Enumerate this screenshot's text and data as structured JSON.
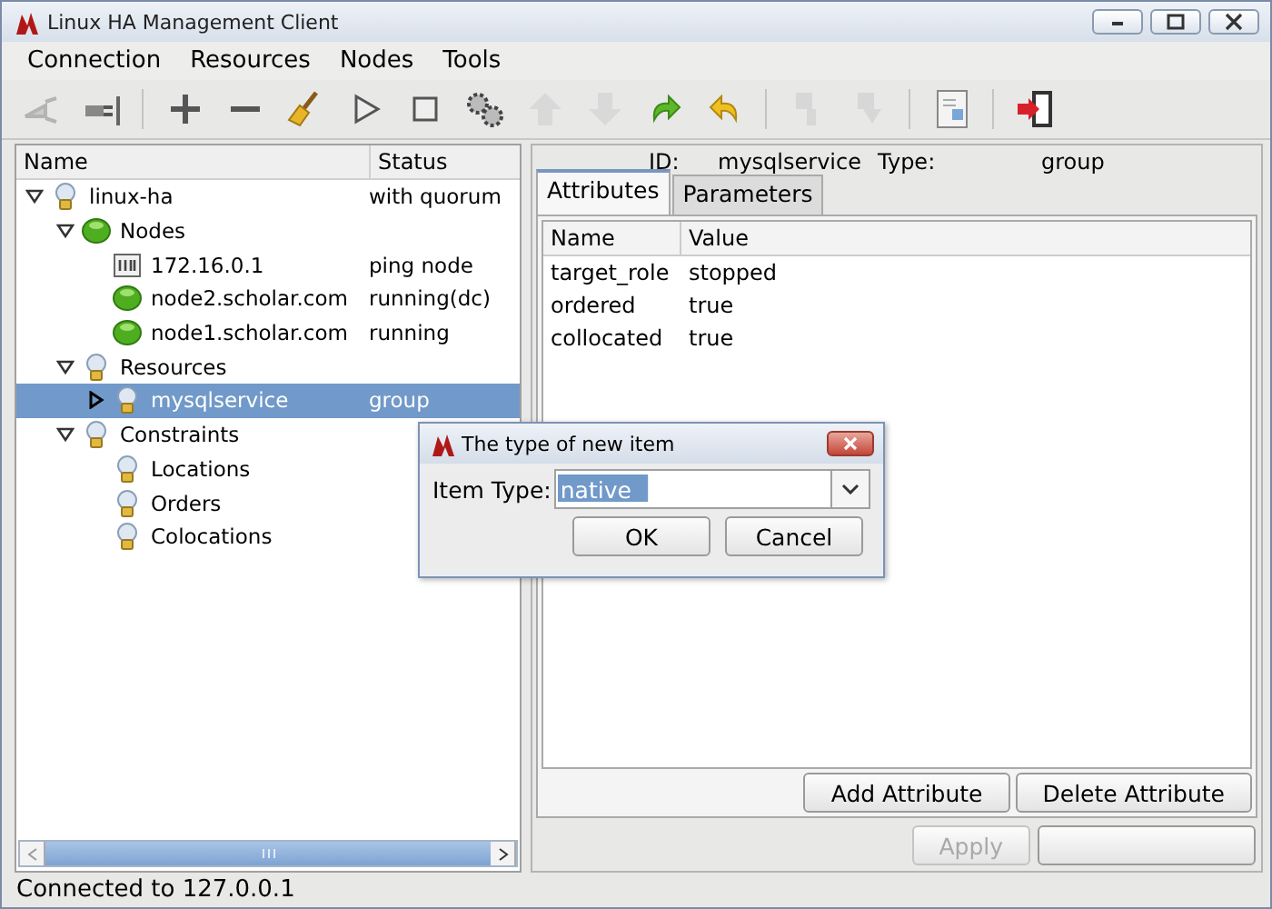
{
  "window": {
    "title": "Linux HA Management Client"
  },
  "menu": [
    "Connection",
    "Resources",
    "Nodes",
    "Tools"
  ],
  "toolbar": [
    {
      "kind": "plug",
      "disabled": true
    },
    {
      "kind": "unplug",
      "disabled": false
    },
    {
      "kind": "separator"
    },
    {
      "kind": "add",
      "disabled": false
    },
    {
      "kind": "remove",
      "disabled": false
    },
    {
      "kind": "broom",
      "disabled": false
    },
    {
      "kind": "play",
      "disabled": false
    },
    {
      "kind": "stop",
      "disabled": false
    },
    {
      "kind": "gears",
      "disabled": false
    },
    {
      "kind": "up",
      "disabled": true
    },
    {
      "kind": "down",
      "disabled": true
    },
    {
      "kind": "redo",
      "disabled": false
    },
    {
      "kind": "undo",
      "disabled": false
    },
    {
      "kind": "separator"
    },
    {
      "kind": "standby",
      "disabled": true
    },
    {
      "kind": "active",
      "disabled": true
    },
    {
      "kind": "separator"
    },
    {
      "kind": "document",
      "disabled": false
    },
    {
      "kind": "separator"
    },
    {
      "kind": "exit",
      "disabled": false
    }
  ],
  "tree": {
    "columns": [
      "Name",
      "Status"
    ],
    "items": [
      {
        "name": "linux-ha",
        "status": "with quorum",
        "kind": "bulb",
        "expanded": true,
        "selected": false,
        "children": [
          {
            "name": "Nodes",
            "kind": "dot",
            "expanded": true,
            "selected": false,
            "children": [
              {
                "name": "172.16.0.1",
                "status": "ping node",
                "kind": "host",
                "selected": false
              },
              {
                "name": "node2.scholar.com",
                "status": "running(dc)",
                "kind": "dot",
                "selected": false
              },
              {
                "name": "node1.scholar.com",
                "status": "running",
                "kind": "dot",
                "selected": false
              }
            ]
          },
          {
            "name": "Resources",
            "kind": "bulb",
            "expanded": true,
            "selected": false,
            "children": [
              {
                "name": "mysqlservice",
                "status": "group",
                "kind": "bulb",
                "expanded": false,
                "selected": true
              }
            ]
          },
          {
            "name": "Constraints",
            "kind": "bulb",
            "expanded": true,
            "selected": false,
            "children": [
              {
                "name": "Locations",
                "kind": "bulb",
                "selected": false
              },
              {
                "name": "Orders",
                "kind": "bulb",
                "selected": false
              },
              {
                "name": "Colocations",
                "kind": "bulb",
                "selected": false
              }
            ]
          }
        ]
      }
    ]
  },
  "details": {
    "id_label": "ID:",
    "id_value": "mysqlservice",
    "type_label": "Type:",
    "type_value": "group",
    "tabs": [
      {
        "label": "Attributes",
        "selected": true
      },
      {
        "label": "Parameters",
        "selected": false
      }
    ],
    "columns": [
      "Name",
      "Value"
    ],
    "rows": [
      [
        "target_role",
        "stopped"
      ],
      [
        "ordered",
        "true"
      ],
      [
        "collocated",
        "true"
      ]
    ],
    "buttons": [
      "Add Attribute",
      "Delete Attribute"
    ],
    "apply": {
      "label": "Apply",
      "disabled": true
    }
  },
  "dialog": {
    "title": "The type of new item",
    "label": "Item Type:",
    "value": "native",
    "buttons": [
      "OK",
      "Cancel"
    ]
  },
  "status_bar": "Connected to 127.0.0.1"
}
